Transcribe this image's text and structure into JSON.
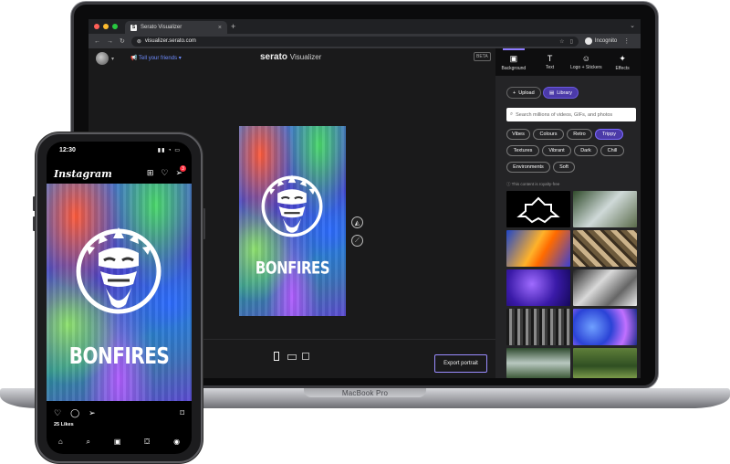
{
  "browser": {
    "tab_title": "Serato Visualizer",
    "tab_favicon": "S",
    "url": "visualizer.serato.com",
    "profile_label": "Incognito"
  },
  "app": {
    "tell_friends": "Tell your friends",
    "brand_name": "serato",
    "brand_product": "Visualizer",
    "beta_label": "BETA",
    "export_label": "Export portrait",
    "art_title": "BONFIRES"
  },
  "panel": {
    "tabs": [
      {
        "label": "Background",
        "icon": "image-icon"
      },
      {
        "label": "Text",
        "icon": "text-icon"
      },
      {
        "label": "Logo + Stickers",
        "icon": "sticker-icon"
      },
      {
        "label": "Effects",
        "icon": "sparkle-icon"
      }
    ],
    "upload_label": "Upload",
    "library_label": "Library",
    "search_placeholder": "Search millions of videos, GIFs, and photos",
    "chips": [
      "Vibes",
      "Colours",
      "Retro",
      "Trippy",
      "Textures",
      "Vibrant",
      "Dark",
      "Chill",
      "Environments",
      "Soft"
    ],
    "active_chip": "Trippy",
    "royalty_note": "ⓘ This content is royalty-free"
  },
  "phone": {
    "time": "12:30",
    "app_name": "Instagram",
    "notification_count": "3",
    "likes": "25 Likes",
    "post_title": "BONFIRES"
  },
  "device": {
    "laptop_model": "MacBook Pro"
  },
  "colors": {
    "accent": "#8e7bff",
    "library_bg": "#4b3aa8",
    "link": "#6f8cff"
  }
}
